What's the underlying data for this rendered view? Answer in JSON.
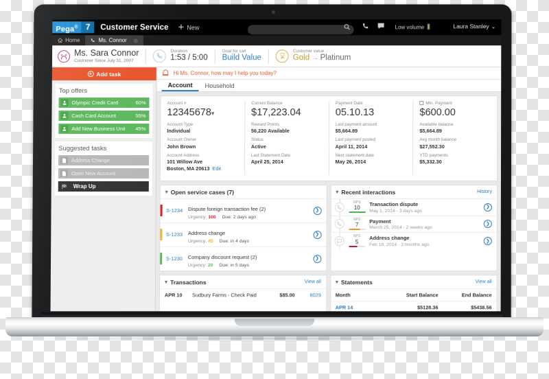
{
  "topbar": {
    "logo_pega": "Pega",
    "logo_sup": "®",
    "logo_version": "7",
    "app_title": "Customer Service",
    "new_label": "New",
    "search_value": "",
    "search_placeholder": "",
    "volume_label": "Low volume",
    "user_name": "Laura Stanley",
    "chevron": "⌄"
  },
  "tabs_bar": {
    "home": "Home",
    "customer_tab": "Ms. Connor"
  },
  "customer_header": {
    "name": "Ms. Sara Connor",
    "since": "Customer Since July 31, 2007",
    "duration_label": "Duration",
    "duration_value": "1:53 / 5:00",
    "goal_label": "Goal for call",
    "goal_value": "Build Value",
    "value_label": "Customer value",
    "value_from": "Gold",
    "value_arrow": "→",
    "value_to": "Platinum"
  },
  "sidebar": {
    "add_task": "Add task",
    "top_offers_title": "Top offers",
    "offers": [
      {
        "label": "Olympic Credit Card",
        "pct": "60%"
      },
      {
        "label": "Cash Card Account",
        "pct": "55%"
      },
      {
        "label": "Add New Business Unit",
        "pct": "45%"
      }
    ],
    "suggested_title": "Suggested tasks",
    "tasks": [
      {
        "label": "Address Change",
        "dark": false
      },
      {
        "label": "Open New Account",
        "dark": false
      },
      {
        "label": "Wrap Up",
        "dark": true
      }
    ]
  },
  "greeting": "Hi Ms. Connor, how may I help you today?",
  "main_tabs": [
    {
      "label": "Account",
      "active": true
    },
    {
      "label": "Household",
      "active": false
    }
  ],
  "account": {
    "col1": {
      "f1_label": "Account #",
      "f1_value": "12345678",
      "f2_label": "Account Type",
      "f2_value": "Individual",
      "f3_label": "Account Owner",
      "f3_value": "John Brown",
      "f4_label": "Account Address",
      "f4_line1": "101 Willow Ave",
      "f4_line2": "Boston, MA  20613",
      "edit": "Edit"
    },
    "col2": {
      "f1_label": "Current Balance",
      "f1_value": "$17,223.04",
      "f2_label": "Reward Points",
      "f2_value": "56,220 Available",
      "f3_label": "Status",
      "f3_value": "Active",
      "f4_label": "Last Statement Date",
      "f4_value": "April 25, 2014"
    },
    "col3": {
      "f1_label": "Payment Date",
      "f1_value": "05.10.13",
      "f2_label": "Last payment amount",
      "f2_value": "$5,664.89",
      "f3_label": "Last payment posted",
      "f3_value": "April 11, 2014",
      "f4_label": "Next statement date",
      "f4_value": "May 26, 2014"
    },
    "col4": {
      "f1_label": "Min. Payment",
      "f1_value": "$600.00",
      "f2_label": "Available balance",
      "f2_value": "$5,664.89",
      "f3_label": "Avg month balance",
      "f3_value": "$27,552.30",
      "f4_label": "YTD payments",
      "f4_value": "$5,332.30"
    }
  },
  "open_cases": {
    "title": "Open service cases (7)",
    "rows": [
      {
        "id": "S-1234",
        "title": "Dispute foreign transaction fee (2)",
        "urgency_label": "Urgency:",
        "urgency": "100",
        "due": "Due: 2 days ago",
        "color": "#e02020"
      },
      {
        "id": "S-1233",
        "title": "Address change",
        "urgency_label": "Urgency:",
        "urgency": "45",
        "due": "Due: in 4 days",
        "color": "#e8b830"
      },
      {
        "id": "S-1230",
        "title": "Company discount request (2)",
        "urgency_label": "Urgency:",
        "urgency": "20",
        "due": "Due:  in 5 days",
        "color": "#5cb85c"
      }
    ]
  },
  "interactions": {
    "title": "Recent interactions",
    "action": "History",
    "rows": [
      {
        "nps_label": "NPS",
        "nps": "10",
        "title": "Transaction dispute",
        "date": "May 1, 2014",
        "ago": " - 3 days ago",
        "bar_color": "#4caf50",
        "bar_pct": "100%",
        "icon": "phone-icon"
      },
      {
        "nps_label": "NPS",
        "nps": "7",
        "title": "Payment",
        "date": "March 25, 2014",
        "ago": " - 2 weeks ago",
        "bar_color": "#e09b28",
        "bar_pct": "70%",
        "icon": "phone-icon"
      },
      {
        "nps_label": "NPS",
        "nps": "5",
        "title": "Address change",
        "date": "Feb 16, 2014",
        "ago": " - 2 months ago",
        "bar_color": "#a8143c",
        "bar_pct": "50%",
        "icon": "chat-icon"
      }
    ]
  },
  "transactions": {
    "title": "Transactions",
    "action": "View all",
    "rows": [
      {
        "date": "APR 10",
        "name": "Sudbury Farms - Check Paid",
        "amount": "$85.00",
        "ref": "8029"
      }
    ]
  },
  "statements": {
    "title": "Statements",
    "action": "View all",
    "headers": {
      "c1": "Month",
      "c2": "Start Balance",
      "c3": "End Balance"
    },
    "rows": [
      {
        "c1": "APR 14",
        "c2": "$5128.36",
        "c3": "$5438.56"
      }
    ]
  },
  "colors": {
    "brand_orange": "#e8552d",
    "brand_blue": "#2a7cc0",
    "green": "#5cb85c",
    "pega_blue": "#1f8fd6"
  }
}
